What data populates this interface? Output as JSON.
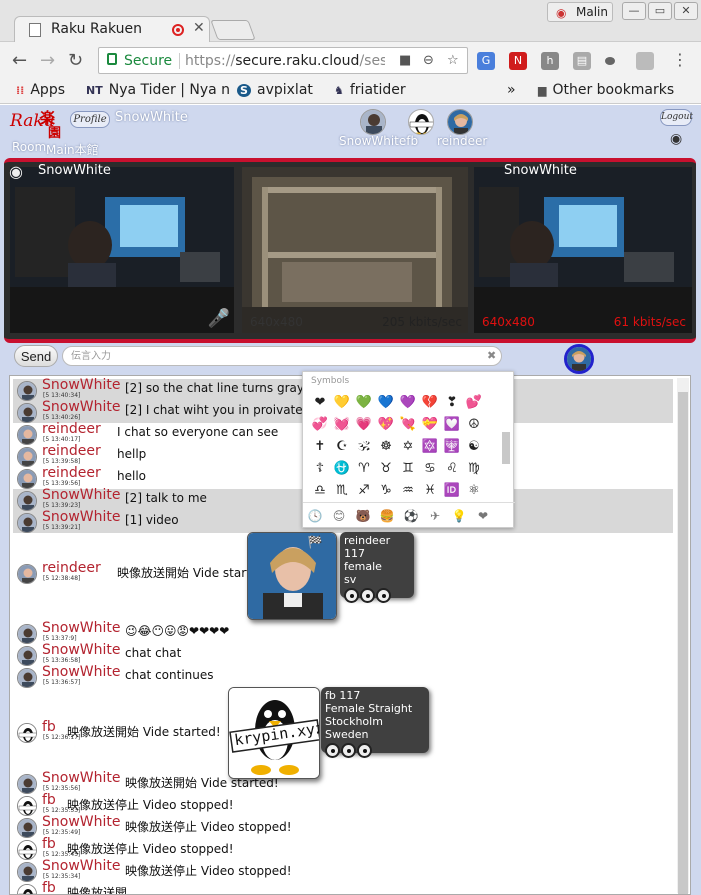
{
  "browser": {
    "tab_title": "Raku Rakuen",
    "profile_name": "Malin",
    "secure_label": "Secure",
    "url_prefix": "https://",
    "url_host": "secure.raku.cloud",
    "url_rest": "/sess...",
    "bookmarks": [
      {
        "label": "Apps",
        "icon": "apps-grid-icon"
      },
      {
        "label": "Nya Tider | Nya n",
        "icon": "nt-logo-icon"
      },
      {
        "label": "avpixlat",
        "icon": "s-logo-icon"
      },
      {
        "label": "friatider",
        "icon": "horse-icon"
      }
    ],
    "overflow": "»",
    "other_bookmarks": "Other bookmarks"
  },
  "header": {
    "logo_text": "Raku",
    "logo_kanji_1": "楽",
    "logo_kanji_2": "園",
    "profile_btn": "Profile",
    "self_name": "SnowWhite",
    "room_label": "Room",
    "room_name": "Main本館",
    "online_users": [
      "SnowWhitefb",
      "reindeer"
    ],
    "logout_btn": "Logout"
  },
  "videos": {
    "label_left": "SnowWhite",
    "label_right": "SnowWhite",
    "v1_res": "",
    "v2_res": "640x480",
    "v2_rate": "205 kbits/sec",
    "v3_res": "640x480",
    "v3_rate": "61 kbits/sec"
  },
  "composer": {
    "send_label": "Send",
    "placeholder": "伝言入力"
  },
  "emoji_picker": {
    "header": "Symbols",
    "rows": [
      [
        "❤",
        "💛",
        "💚",
        "💙",
        "💜",
        "💔",
        "❣",
        "💕"
      ],
      [
        "💞",
        "💓",
        "💗",
        "💖",
        "💘",
        "💝",
        "💟",
        "☮"
      ],
      [
        "✝",
        "☪",
        "🕉",
        "☸",
        "✡",
        "🔯",
        "🕎",
        "☯"
      ],
      [
        "☦",
        "⛎",
        "♈",
        "♉",
        "♊",
        "♋",
        "♌",
        "♍"
      ],
      [
        "♎",
        "♏",
        "♐",
        "♑",
        "♒",
        "♓",
        "🆔",
        "⚛"
      ]
    ],
    "categories": [
      "🕓",
      "😊",
      "🐻",
      "🍔",
      "⚽",
      "✈",
      "💡",
      "❤",
      "🏁"
    ]
  },
  "colors": {
    "name": "#b3232f",
    "stage_border": "#c8102e",
    "page_bg": "#cfd8ee"
  },
  "messages": [
    {
      "name": "SnowWhite",
      "time": "[5 13:40:34]",
      "text": "[2] so the chat line turns gray",
      "gray": true
    },
    {
      "name": "SnowWhite",
      "time": "[5 13:40:26]",
      "text": "[2] I chat wiht you in proivate",
      "gray": true
    },
    {
      "name": "reindeer",
      "time": "[5 13:40:17]",
      "text": "I chat so everyone can see",
      "gray": false
    },
    {
      "name": "reindeer",
      "time": "[5 13:39:58]",
      "text": "hellp",
      "gray": false
    },
    {
      "name": "reindeer",
      "time": "[5 13:39:56]",
      "text": "hello",
      "gray": false
    },
    {
      "name": "SnowWhite",
      "time": "[5 13:39:23]",
      "text": "[2] talk to me",
      "gray": true
    },
    {
      "name": "SnowWhite",
      "time": "[5 13:39:21]",
      "text": "[1] video",
      "gray": true
    },
    {
      "name": "reindeer",
      "time": "[5 12:38:48]",
      "text": "映像放送開始 Vide started!",
      "gray": false
    },
    {
      "name": "SnowWhite",
      "time": "[5 13:37:9]",
      "text": "😉😂😶😛😡❤❤❤❤",
      "gray": false
    },
    {
      "name": "SnowWhite",
      "time": "[5 13:36:58]",
      "text": "chat chat",
      "gray": false
    },
    {
      "name": "SnowWhite",
      "time": "[5 13:36:57]",
      "text": "chat continues",
      "gray": false
    },
    {
      "name": "fb",
      "time": "[5 12:36:17]",
      "text": "映像放送開始 Vide started!",
      "gray": false
    },
    {
      "name": "SnowWhite",
      "time": "[5 12:35:56]",
      "text": "映像放送開始 Vide started!",
      "gray": false
    },
    {
      "name": "fb",
      "time": "[5 12:35:53]",
      "text": "映像放送停止 Video stopped!",
      "gray": false
    },
    {
      "name": "SnowWhite",
      "time": "[5 12:35:49]",
      "text": "映像放送停止 Video stopped!",
      "gray": false
    },
    {
      "name": "fb",
      "time": "[5 12:35:45]",
      "text": "映像放送停止 Video stopped!",
      "gray": false
    },
    {
      "name": "SnowWhite",
      "time": "[5 12:35:34]",
      "text": "映像放送停止 Video stopped!",
      "gray": false
    },
    {
      "name": "fb",
      "time": "",
      "text": "映像放送開",
      "gray": false
    }
  ],
  "cards": {
    "reindeer": {
      "l1": "reindeer 117",
      "l2": "female",
      "l3": "sv"
    },
    "fb": {
      "l1": "fb 117",
      "l2": "Female Straight",
      "l3": "Stockholm Sweden",
      "logo": "krypin.xyz"
    }
  }
}
